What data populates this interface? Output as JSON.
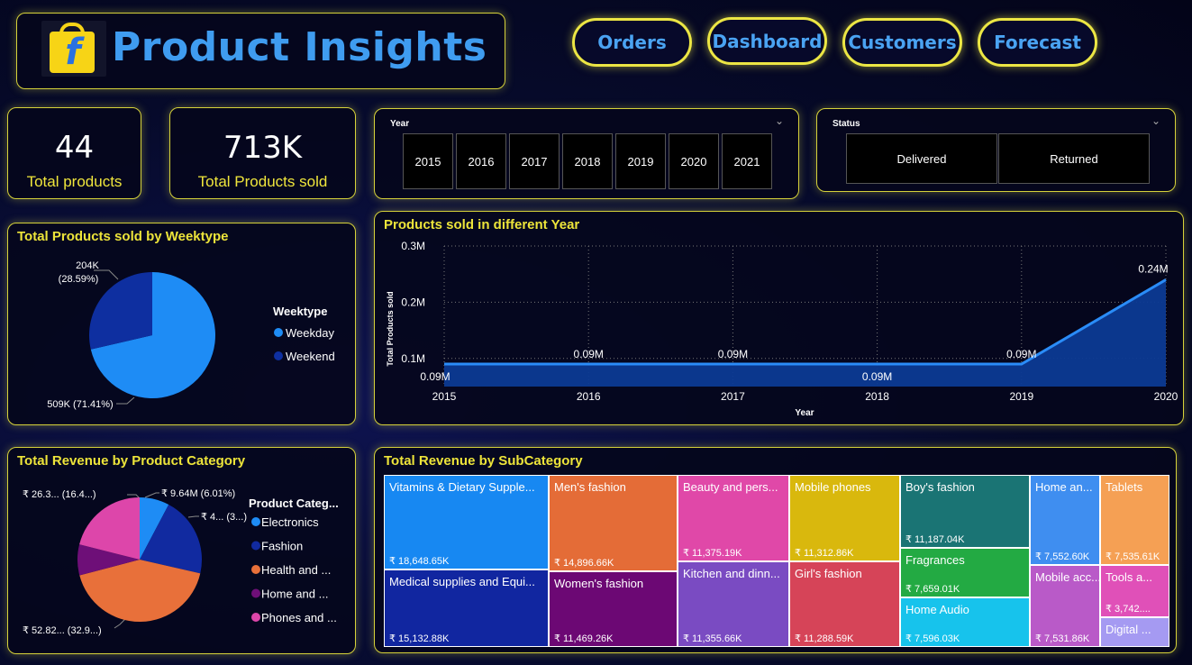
{
  "header": {
    "title": "Product Insights"
  },
  "nav": [
    "Orders",
    "Dashboard",
    "Customers",
    "Forecast"
  ],
  "kpis": [
    {
      "value": "44",
      "label": "Total products"
    },
    {
      "value": "713K",
      "label": "Total Products sold"
    }
  ],
  "year_slicer": {
    "title": "Year",
    "chevron": "⌄",
    "options": [
      "2015",
      "2016",
      "2017",
      "2018",
      "2019",
      "2020",
      "2021"
    ]
  },
  "status_slicer": {
    "title": "Status",
    "chevron": "⌄",
    "options": [
      "Delivered",
      "Returned"
    ]
  },
  "weektype_chart": {
    "title": "Total Products sold by Weektype",
    "legend_title": "Weektype",
    "legend": [
      {
        "name": "Weekday",
        "color": "#1e8cf5"
      },
      {
        "name": "Weekend",
        "color": "#0e2fa0"
      }
    ],
    "label_weekend_line1": "204K",
    "label_weekend_line2": "(28.59%)",
    "label_weekday": "509K (71.41%)"
  },
  "year_chart": {
    "title": "Products sold in different Year",
    "xlabel": "Year",
    "ylabel": "Total Products sold"
  },
  "chart_data": [
    {
      "type": "pie",
      "title": "Total Products sold by Weektype",
      "labels": [
        "Weekday",
        "Weekend"
      ],
      "values": [
        509,
        204
      ],
      "percentages": [
        71.41,
        28.59
      ],
      "colors": [
        "#1e8cf5",
        "#0e2fa0"
      ],
      "legend": "right"
    },
    {
      "type": "area",
      "title": "Products sold in different Year",
      "xlabel": "Year",
      "ylabel": "Total Products sold",
      "x": [
        "2015",
        "2016",
        "2017",
        "2018",
        "2019",
        "2020"
      ],
      "values": [
        0.09,
        0.09,
        0.09,
        0.09,
        0.09,
        0.24
      ],
      "data_labels": [
        "0.09M",
        "0.09M",
        "0.09M",
        "0.09M",
        "0.09M",
        "0.24M"
      ],
      "y_ticks": [
        "0.3M",
        "0.2M",
        "0.1M"
      ],
      "ylim": [
        0.05,
        0.3
      ],
      "grid": true
    },
    {
      "type": "pie",
      "title": "Total Revenue by Product Category",
      "legend_title": "Product Categ...",
      "labels": [
        "Electronics",
        "Fashion",
        "Health and ...",
        "Home and ...",
        "Phones and ..."
      ],
      "values": [
        9.64,
        26.0,
        52.82,
        10.0,
        26.3
      ],
      "colors": [
        "#1e8cf5",
        "#112aa0",
        "#e8703a",
        "#6e0f78",
        "#dd46aa"
      ],
      "data_labels": [
        "₹ 9.64M (6.01%)",
        "₹ 4... (3...)",
        "₹ 52.82... (32.9...)",
        "₹ 26.3... (16.4...)"
      ],
      "legend": "right"
    },
    {
      "type": "treemap",
      "title": "Total Revenue by SubCategory",
      "items": [
        {
          "name": "Vitamins & Dietary Supple...",
          "value": "₹ 18,648.65K",
          "color": "#1788f2"
        },
        {
          "name": "Medical supplies and Equi...",
          "value": "₹ 15,132.88K",
          "color": "#1126a0"
        },
        {
          "name": "Men's fashion",
          "value": "₹ 14,896.66K",
          "color": "#e46c37"
        },
        {
          "name": "Women's fashion",
          "value": "₹ 11,469.26K",
          "color": "#6c0874"
        },
        {
          "name": "Beauty and pers...",
          "value": "₹ 11,375.19K",
          "color": "#e048a8"
        },
        {
          "name": "Kitchen and dinn...",
          "value": "₹ 11,355.66K",
          "color": "#7a4bc2"
        },
        {
          "name": "Mobile phones",
          "value": "₹ 11,312.86K",
          "color": "#d9b80d"
        },
        {
          "name": "Girl's fashion",
          "value": "₹ 11,288.59K",
          "color": "#d64458"
        },
        {
          "name": "Boy's fashion",
          "value": "₹ 11,187.04K",
          "color": "#1a7474"
        },
        {
          "name": "Fragrances",
          "value": "₹ 7,659.01K",
          "color": "#23aa43"
        },
        {
          "name": "Home Audio",
          "value": "₹ 7,596.03K",
          "color": "#17c3ec"
        },
        {
          "name": "Home an...",
          "value": "₹ 7,552.60K",
          "color": "#3f8ef0"
        },
        {
          "name": "Mobile acc...",
          "value": "₹ 7,531.86K",
          "color": "#b95ac8"
        },
        {
          "name": "Tablets",
          "value": "₹ 7,535.61K",
          "color": "#f5a054"
        },
        {
          "name": "Tools a...",
          "value": "₹ 3,742....",
          "color": "#e050b8"
        },
        {
          "name": "Digital ...",
          "value": "",
          "color": "#a59af2"
        }
      ]
    }
  ],
  "category_chart": {
    "title": "Total Revenue by Product Category",
    "legend_title": "Product Categ..."
  },
  "subcategory_chart": {
    "title": "Total Revenue by SubCategory"
  }
}
